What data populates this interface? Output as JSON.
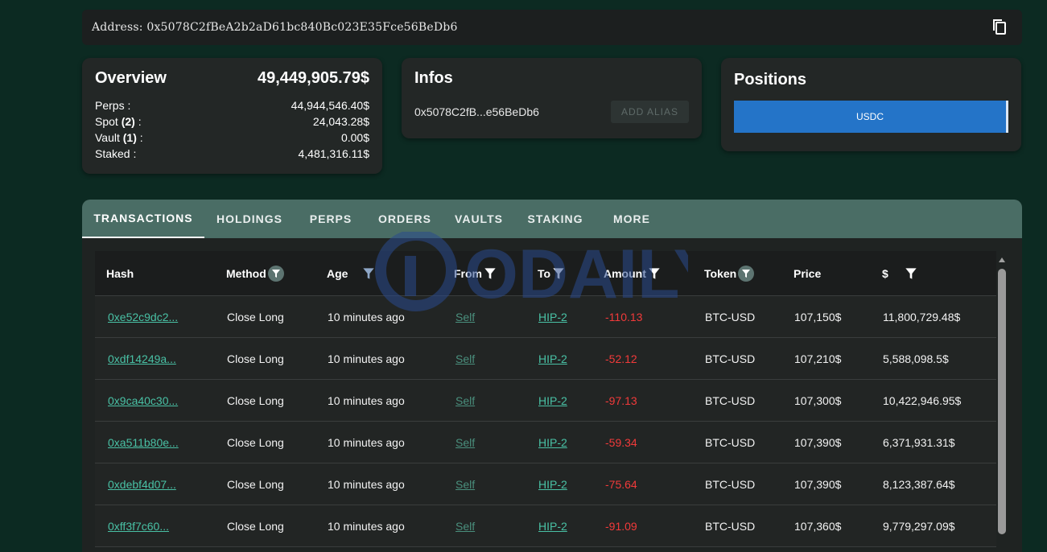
{
  "address_bar": {
    "label": "Address:  0x5078C2fBeA2b2aD61bc840Bc023E35Fce56BeDb6",
    "copy_icon": "copy-icon"
  },
  "overview": {
    "title": "Overview",
    "total": "49,449,905.79$",
    "rows": [
      {
        "label": "Perps :",
        "value": "44,944,546.40$"
      },
      {
        "label_pre": "Spot ",
        "label_bold": "(2)",
        "label_post": " :",
        "value": "24,043.28$"
      },
      {
        "label_pre": "Vault ",
        "label_bold": "(1)",
        "label_post": " :",
        "value": "0.00$"
      },
      {
        "label": "Staked :",
        "value": "4,481,316.11$"
      }
    ]
  },
  "infos": {
    "title": "Infos",
    "short_address": "0x5078C2fB...e56BeDb6",
    "alias_button": "ADD ALIAS"
  },
  "positions": {
    "title": "Positions",
    "bar_label": "USDC",
    "bar_color": "#2474c8"
  },
  "tabs": [
    "TRANSACTIONS",
    "HOLDINGS",
    "PERPS",
    "ORDERS",
    "VAULTS",
    "STAKING",
    "MORE"
  ],
  "active_tab": "TRANSACTIONS",
  "table": {
    "headers": {
      "hash": "Hash",
      "method": "Method",
      "age": "Age",
      "from": "From",
      "to": "To",
      "amount": "Amount",
      "token": "Token",
      "price": "Price",
      "usd": "$"
    },
    "rows": [
      {
        "hash": "0xe52c9dc2...",
        "method": "Close Long",
        "age": "10 minutes ago",
        "from": "Self",
        "to": "HIP-2",
        "amount": "-110.13",
        "token": "BTC-USD",
        "price": "107,150$",
        "usd": "11,800,729.48$"
      },
      {
        "hash": "0xdf14249a...",
        "method": "Close Long",
        "age": "10 minutes ago",
        "from": "Self",
        "to": "HIP-2",
        "amount": "-52.12",
        "token": "BTC-USD",
        "price": "107,210$",
        "usd": "5,588,098.5$"
      },
      {
        "hash": "0x9ca40c30...",
        "method": "Close Long",
        "age": "10 minutes ago",
        "from": "Self",
        "to": "HIP-2",
        "amount": "-97.13",
        "token": "BTC-USD",
        "price": "107,300$",
        "usd": "10,422,946.95$"
      },
      {
        "hash": "0xa511b80e...",
        "method": "Close Long",
        "age": "10 minutes ago",
        "from": "Self",
        "to": "HIP-2",
        "amount": "-59.34",
        "token": "BTC-USD",
        "price": "107,390$",
        "usd": "6,371,931.31$"
      },
      {
        "hash": "0xdebf4d07...",
        "method": "Close Long",
        "age": "10 minutes ago",
        "from": "Self",
        "to": "HIP-2",
        "amount": "-75.64",
        "token": "BTC-USD",
        "price": "107,390$",
        "usd": "8,123,387.64$"
      },
      {
        "hash": "0xff3f7c60...",
        "method": "Close Long",
        "age": "10 minutes ago",
        "from": "Self",
        "to": "HIP-2",
        "amount": "-91.09",
        "token": "BTC-USD",
        "price": "107,360$",
        "usd": "9,779,297.09$"
      }
    ]
  },
  "watermark": "ODAILY",
  "colors": {
    "background": "#0c2a22",
    "tab_bar": "#4a6d65",
    "link": "#49c1a5",
    "negative": "#f23a3a"
  }
}
